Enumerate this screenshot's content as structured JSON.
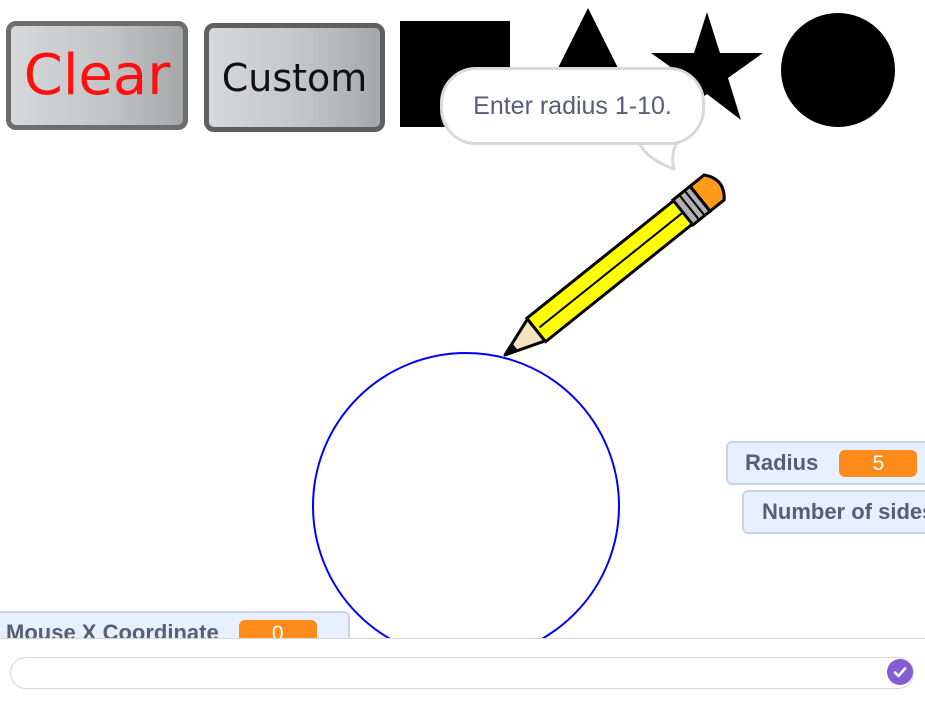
{
  "toolbar": {
    "clear_label": "Clear",
    "custom_label": "Custom",
    "shapes": [
      "square",
      "triangle",
      "star",
      "circle"
    ]
  },
  "speech_bubble": {
    "text": "Enter radius 1-10."
  },
  "monitors": {
    "radius": {
      "label": "Radius",
      "value": "5"
    },
    "sides": {
      "label": "Number of sides"
    },
    "mouse_x": {
      "label": "Mouse X Coordinate",
      "value": "0"
    }
  },
  "canvas": {
    "drawn_shape": "circle",
    "stroke_color": "#0000ff"
  },
  "answer": {
    "value": ""
  },
  "colors": {
    "monitor_value": "#ff8c1a",
    "submit_button": "#855cd6",
    "clear_text": "#ff1010"
  }
}
